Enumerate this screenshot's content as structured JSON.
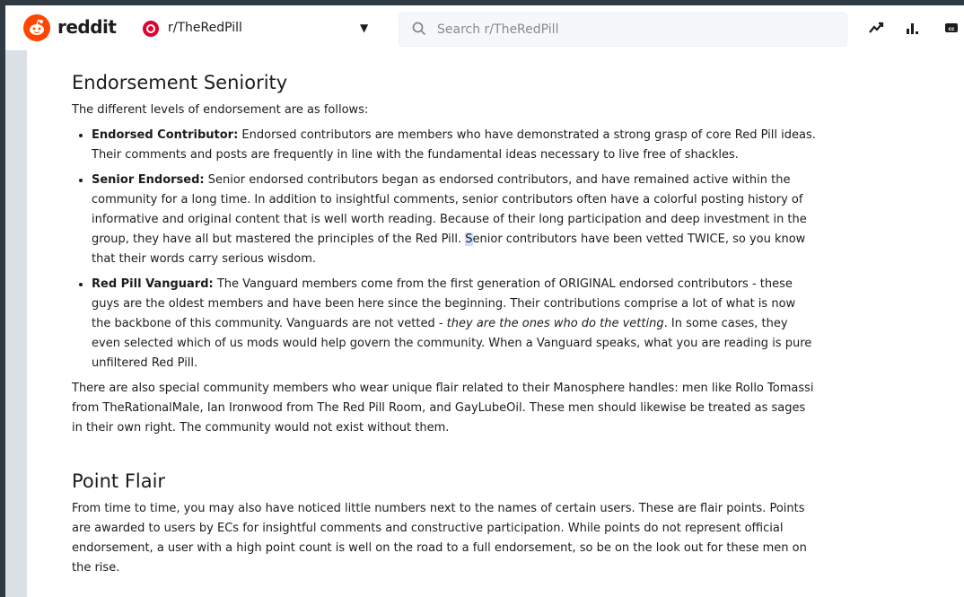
{
  "header": {
    "logo_text": "reddit",
    "subreddit": "r/TheRedPill",
    "search_placeholder": "Search r/TheRedPill",
    "icons": [
      "trending-icon",
      "stats-icon",
      "closed-captions-icon"
    ],
    "brand_color": "#ff4500"
  },
  "content": {
    "sections": [
      {
        "title": "Endorsement Seniority",
        "intro": "The different levels of endorsement are as follows:",
        "items": [
          {
            "label": "Endorsed Contributor:",
            "text": " Endorsed contributors are members who have demonstrated a strong grasp of core Red Pill ideas. Their comments and posts are frequently in line with the fundamental ideas necessary to live free of shackles."
          },
          {
            "label": "Senior Endorsed:",
            "text_a": " Senior endorsed contributors began as endorsed contributors, and have remained active within the community for a long time. In addition to insightful comments, senior contributors often have a colorful posting history of informative and original content that is well worth reading. Because of their long participation and deep investment in the group, they have all but mastered the principles of the Red Pill. ",
            "text_hl": "S",
            "text_b": "enior contributors have been vetted TWICE, so you know that their words carry serious wisdom."
          },
          {
            "label": "Red Pill Vanguard:",
            "text_a": " The Vanguard members come from the first generation of ORIGINAL endorsed contributors - these guys are the oldest members and have been here since the beginning. Their contributions comprise a lot of what is now the backbone of this community. Vanguards are not vetted - ",
            "text_em": "they are the ones who do the vetting",
            "text_b": ". In some cases, they even selected which of us mods would help govern the community. When a Vanguard speaks, what you are reading is pure unfiltered Red Pill."
          }
        ],
        "outro": "There are also special community members who wear unique flair related to their Manosphere handles: men like Rollo Tomassi from TheRationalMale, Ian Ironwood from The Red Pill Room, and GayLubeOil. These men should likewise be treated as sages in their own right. The community would not exist without them."
      },
      {
        "title": "Point Flair",
        "body": "From time to time, you may also have noticed little numbers next to the names of certain users. These are flair points. Points are awarded to users by ECs for insightful comments and constructive participation. While points do not represent official endorsement, a user with a high point count is well on the road to a full endorsement, so be on the look out for these men on the rise."
      }
    ]
  }
}
